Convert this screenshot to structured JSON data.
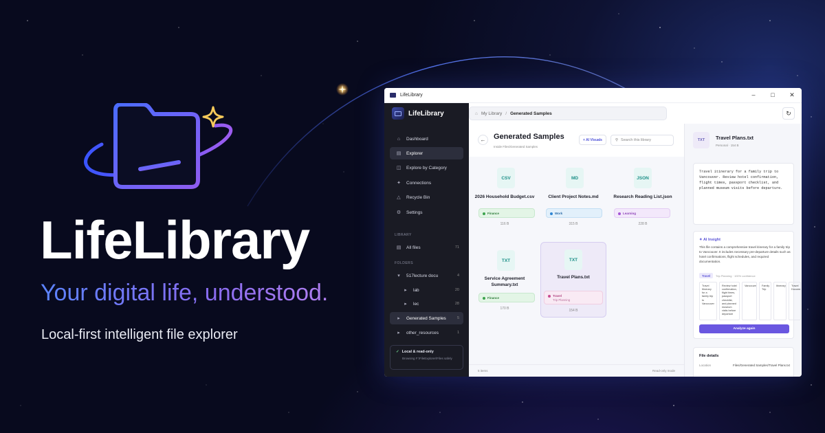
{
  "brand": {
    "title": "LifeLibrary",
    "tagline": "Your digital life, understood.",
    "subtitle": "Local-first intelligent file explorer"
  },
  "window": {
    "title": "LifeLibrary",
    "controls": [
      "minimize-icon",
      "maximize-icon",
      "close-icon"
    ]
  },
  "app": {
    "name": "LifeLibrary",
    "breadcrumb": [
      "My Library",
      "Generated Samples"
    ],
    "refresh_icon": "refresh-icon"
  },
  "sidebar": {
    "nav": [
      {
        "label": "Dashboard",
        "icon": "home-icon"
      },
      {
        "label": "Explorer",
        "icon": "explorer-icon",
        "active": true
      },
      {
        "label": "Explore by Category",
        "icon": "category-icon"
      },
      {
        "label": "Connections",
        "icon": "connections-icon"
      },
      {
        "label": "Recycle Bin",
        "icon": "recycle-icon"
      },
      {
        "label": "Settings",
        "icon": "settings-icon"
      }
    ],
    "library_header": "LIBRARY",
    "all_files": {
      "label": "All files",
      "count": "71"
    },
    "folders_header": "FOLDERS",
    "folders": [
      {
        "label": "517lecture docu",
        "count": "4"
      },
      {
        "label": "lab",
        "count": "20"
      },
      {
        "label": "lec",
        "count": "28"
      },
      {
        "label": "Generated Samples",
        "count": "5",
        "active": true
      },
      {
        "label": "other_resources",
        "count": "1"
      }
    ],
    "status": {
      "title": "Local & read-only",
      "sub": "Browsing F:\\FileExplorer\\Files safely"
    }
  },
  "main": {
    "title": "Generated Samples",
    "subtitle": "Inside Files/Generated Samples",
    "ai_button": "+ AI Visuals",
    "search_placeholder": "Search this library",
    "files": [
      {
        "type": "CSV",
        "name": "2026 Household Budget.csv",
        "tag": "Finance",
        "tag_class": "fin",
        "size": "116 B"
      },
      {
        "type": "MD",
        "name": "Client Project Notes.md",
        "tag": "Work",
        "tag_class": "work",
        "size": "315 B"
      },
      {
        "type": "JSON",
        "name": "Research Reading List.json",
        "tag": "Learning",
        "tag_class": "learn",
        "size": "228 B"
      },
      {
        "type": "TXT",
        "name": "Service Agreement Summary.txt",
        "tag": "Finance",
        "tag_class": "fin",
        "size": "170 B"
      },
      {
        "type": "TXT",
        "name": "Travel Plans.txt",
        "tag": "Travel",
        "tag_sub": "Trip Planning",
        "tag_class": "travel",
        "size": "154 B",
        "selected": true
      }
    ],
    "footer_left": "5 items",
    "footer_right": "Read-only mode"
  },
  "details": {
    "type": "TXT",
    "name": "Travel Plans.txt",
    "meta": "Personal · 154 B",
    "content": "Travel itinerary for a family trip to Vancouver. Review hotel confirmation, flight times, passport checklist, and planned museum visits before departure.",
    "insight_title": "AI Insight",
    "insight_body": "This file contains a comprehensive travel itinerary for a family trip to Vancouver. It includes necessary pre-departure details such as hotel confirmations, flight schedules, and required documentation.",
    "insight_chip": "Travel",
    "insight_tags": "Trip Planning · 100% confidence",
    "insight_cols": [
      "Travel Itinerary for a family trip to Vancouver",
      "Review hotel confirmation, flight times, passport checklist, and planned museum visits before departure",
      "Vancouver",
      "Family Trip",
      "Itinerary",
      "Travel Document"
    ],
    "analyze_button": "Analyze again",
    "file_details_title": "File details",
    "location_label": "Location",
    "location_value": "Files/Generated Samples/Travel Plans.txt"
  }
}
